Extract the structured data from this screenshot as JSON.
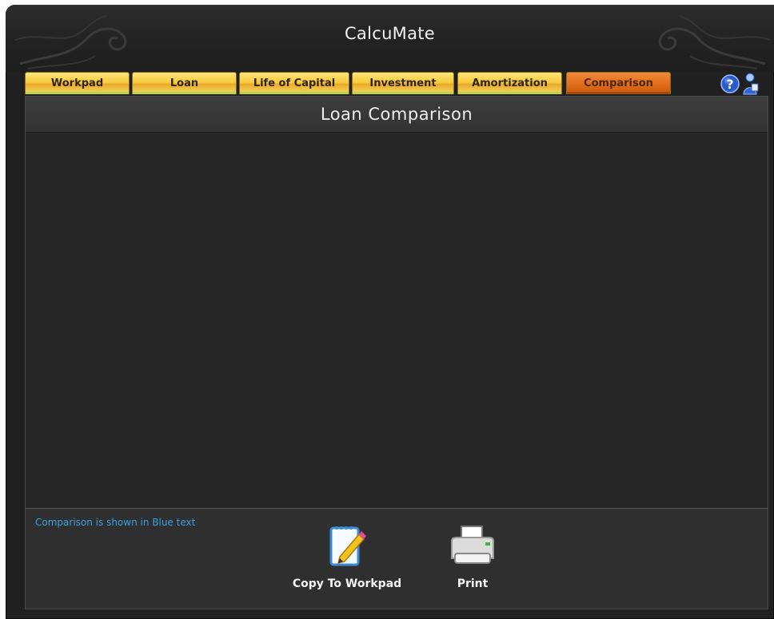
{
  "app": {
    "title": "CalcuMate"
  },
  "tabs": [
    {
      "label": "Workpad",
      "active": false
    },
    {
      "label": "Loan",
      "active": false
    },
    {
      "label": "Life of Capital",
      "active": false
    },
    {
      "label": "Investment",
      "active": false
    },
    {
      "label": "Amortization",
      "active": false
    },
    {
      "label": "Comparison",
      "active": true
    }
  ],
  "panel": {
    "title": "Loan Comparison"
  },
  "footer": {
    "note": "Comparison is shown in Blue text",
    "copy_label": "Copy To Workpad",
    "print_label": "Print"
  },
  "icons": {
    "help": "help-icon",
    "figure": "user-figure-icon",
    "copy": "notepad-pencil-icon",
    "print": "printer-icon"
  },
  "colors": {
    "background": "#202020",
    "tab": "#f5c93a",
    "active_tab": "#e36f1b",
    "note_text": "#3aa0e6"
  }
}
